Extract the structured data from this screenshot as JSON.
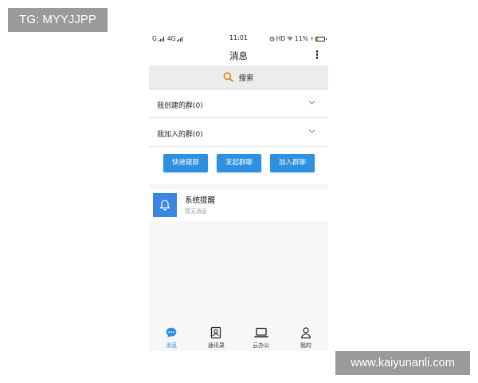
{
  "watermarks": {
    "top": "TG: MYYJJPP",
    "bottom": "www.kaiyunanli.com"
  },
  "status_bar": {
    "left": [
      "G",
      "4G"
    ],
    "time": "11:01",
    "hd": "HD",
    "battery": "11%"
  },
  "header": {
    "title": "消息",
    "more_icon": "more-vertical-icon"
  },
  "search": {
    "label": "搜索",
    "icon": "search-icon",
    "icon_color": "#e08a1e"
  },
  "groups": [
    {
      "label": "我创建的群(0)",
      "icon": "chevron-down-icon"
    },
    {
      "label": "我加入的群(0)",
      "icon": "chevron-down-icon"
    }
  ],
  "actions": [
    {
      "label": "快速建群"
    },
    {
      "label": "发起群聊"
    },
    {
      "label": "加入群聊"
    }
  ],
  "system_message": {
    "title": "系统提醒",
    "subtitle": "暂无消息",
    "icon": "bell-icon"
  },
  "tabs": [
    {
      "label": "消息",
      "icon": "chat-bubble-icon",
      "active": true
    },
    {
      "label": "通讯录",
      "icon": "contacts-icon",
      "active": false
    },
    {
      "label": "云办公",
      "icon": "laptop-icon",
      "active": false
    },
    {
      "label": "我的",
      "icon": "person-icon",
      "active": false
    }
  ],
  "colors": {
    "accent": "#2f8fe0",
    "system_icon_bg": "#3b86e0",
    "watermark_bg": "#9a9a9a"
  }
}
